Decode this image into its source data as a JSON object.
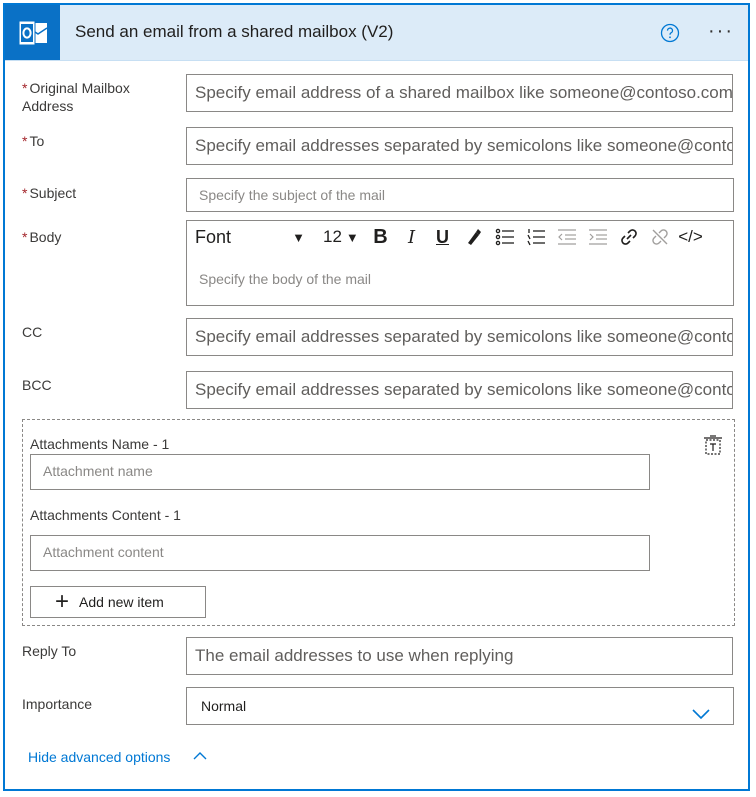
{
  "header": {
    "title": "Send an email from a shared mailbox (V2)",
    "app_icon": "outlook-icon",
    "help_icon": "help-circle-icon",
    "more_label": "···",
    "colors": {
      "accent": "#0078d4",
      "header_bg": "#dcebf8",
      "icon_bg": "#0a71c6",
      "required": "#a4262c"
    }
  },
  "fields": {
    "original_mailbox": {
      "label": "Original Mailbox Address",
      "required": "*",
      "placeholder": "Specify email address of a shared mailbox like someone@contoso.com"
    },
    "to": {
      "label": "To",
      "required": "*",
      "placeholder": "Specify email addresses separated by semicolons like someone@contoso.com"
    },
    "subject": {
      "label": "Subject",
      "required": "*",
      "placeholder": "Specify the subject of the mail"
    },
    "body": {
      "label": "Body",
      "required": "*",
      "placeholder": "Specify the body of the mail"
    },
    "cc": {
      "label": "CC",
      "placeholder": "Specify email addresses separated by semicolons like someone@contoso.com"
    },
    "bcc": {
      "label": "BCC",
      "placeholder": "Specify email addresses separated by semicolons like someone@contoso.com"
    },
    "reply_to": {
      "label": "Reply To",
      "placeholder": "The email addresses to use when replying"
    },
    "importance": {
      "label": "Importance",
      "value": "Normal"
    }
  },
  "toolbar": {
    "font_label": "Font",
    "size_label": "12",
    "bold": "B",
    "italic": "I",
    "underline": "U",
    "code": "</>"
  },
  "attachments": {
    "name_label": "Attachments Name - 1",
    "name_placeholder": "Attachment name",
    "content_label": "Attachments Content - 1",
    "content_placeholder": "Attachment content",
    "add_label": "Add new item"
  },
  "footer": {
    "hide_label": "Hide advanced options"
  }
}
